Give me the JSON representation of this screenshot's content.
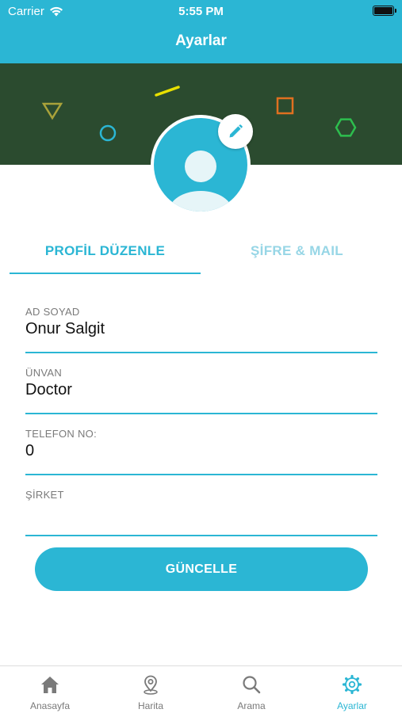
{
  "status_bar": {
    "carrier": "Carrier",
    "time": "5:55 PM"
  },
  "header": {
    "title": "Ayarlar"
  },
  "profile": {
    "edit_icon": "pencil-icon",
    "avatar_icon": "person-icon"
  },
  "tabs": [
    {
      "label": "PROFİL DÜZENLE",
      "active": true
    },
    {
      "label": "ŞİFRE & MAIL",
      "active": false
    }
  ],
  "form": {
    "fields": [
      {
        "label": "AD SOYAD",
        "value": "Onur Salgit"
      },
      {
        "label": "ÜNVAN",
        "value": "Doctor"
      },
      {
        "label": "TELEFON NO:",
        "value": "0"
      },
      {
        "label": "ŞİRKET",
        "value": ""
      }
    ],
    "submit_label": "GÜNCELLE"
  },
  "tabbar": [
    {
      "label": "Anasayfa",
      "icon": "home-icon",
      "active": false
    },
    {
      "label": "Harita",
      "icon": "map-pin-icon",
      "active": false
    },
    {
      "label": "Arama",
      "icon": "search-icon",
      "active": false
    },
    {
      "label": "Ayarlar",
      "icon": "gear-icon",
      "active": true
    }
  ],
  "colors": {
    "primary": "#2BB6D4",
    "banner": "#2B4B2F",
    "tab_inactive": "#97D6E6",
    "label_gray": "#7A7A7A"
  }
}
